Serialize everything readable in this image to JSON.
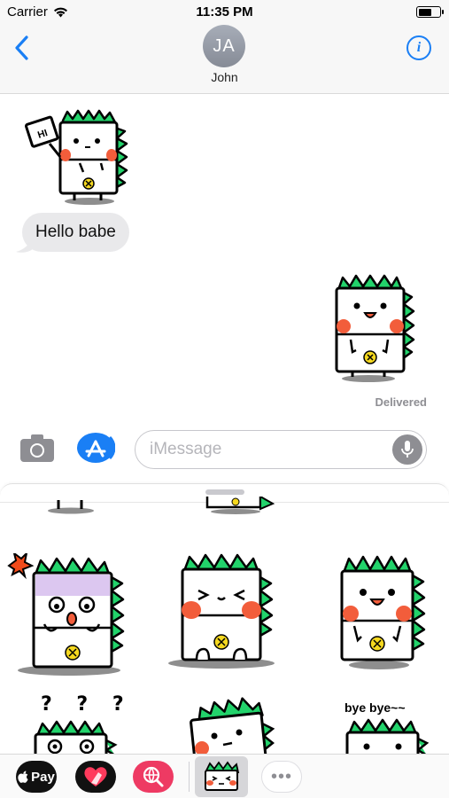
{
  "status_bar": {
    "carrier": "Carrier",
    "time": "11:35 PM",
    "wifi_icon": "wifi-icon",
    "battery_icon": "battery-icon"
  },
  "header": {
    "back_icon": "chevron-left-icon",
    "avatar_initials": "JA",
    "contact_name": "John",
    "info_icon": "info-icon"
  },
  "conversation": {
    "received_sticker": {
      "sign_text": "HI"
    },
    "received_message": "Hello babe",
    "sent_status": "Delivered"
  },
  "input_bar": {
    "placeholder": "iMessage",
    "value": "",
    "camera_icon": "camera-icon",
    "apps_icon": "app-store-icon",
    "mic_icon": "microphone-icon"
  },
  "sticker_drawer": {
    "question_marks": "? ? ?",
    "bye_caption": "bye bye~~"
  },
  "app_strip": {
    "apple_pay_label": "Pay",
    "more_label": "•••"
  },
  "colors": {
    "accent_blue": "#1a7ff5",
    "sticker_green": "#22d36b",
    "sticker_cheek": "#f25d3b",
    "button_yellow": "#f5d81f"
  }
}
